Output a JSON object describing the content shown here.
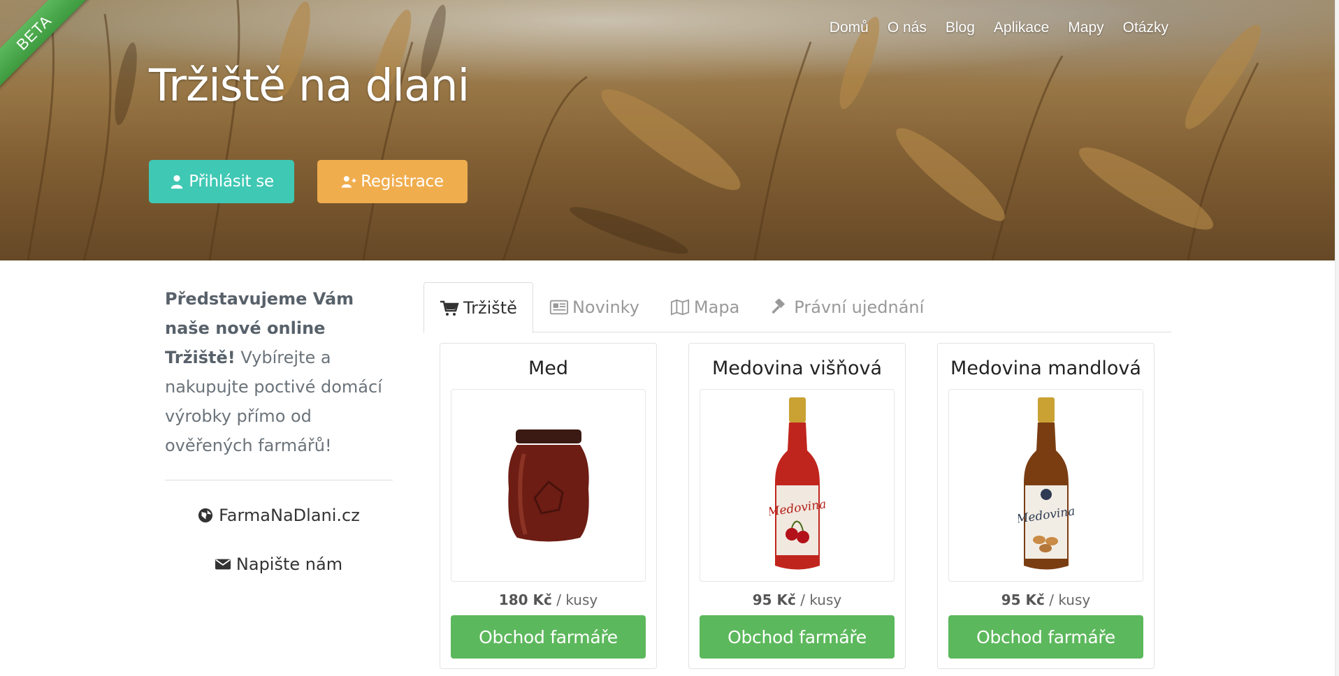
{
  "beta_label": "BETA",
  "header": {
    "title": "Tržiště na dlani",
    "nav": [
      "Domů",
      "O nás",
      "Blog",
      "Aplikace",
      "Mapy",
      "Otázky"
    ],
    "login_label": "Přihlásit se",
    "register_label": "Registrace"
  },
  "sidebar": {
    "intro_bold": "Představujeme Vám naše nové online Tržiště!",
    "intro_text": "Vybírejte a nakupujte poctivé domácí výrobky přímo od ověřených farmářů!",
    "links": [
      {
        "label": "FarmaNaDlani.cz",
        "icon": "globe-icon"
      },
      {
        "label": "Napište nám",
        "icon": "envelope-icon"
      }
    ]
  },
  "tabs": [
    {
      "label": "Tržiště",
      "icon": "cart-icon",
      "active": true
    },
    {
      "label": "Novinky",
      "icon": "newspaper-icon",
      "active": false
    },
    {
      "label": "Mapa",
      "icon": "map-icon",
      "active": false
    },
    {
      "label": "Právní ujednání",
      "icon": "gavel-icon",
      "active": false
    }
  ],
  "products": [
    {
      "name": "Med",
      "price": "180 Kč",
      "unit": " / kusy",
      "button": "Obchod farmáře",
      "image": "honey-jar"
    },
    {
      "name": "Medovina višňová",
      "price": "95 Kč",
      "unit": " / kusy",
      "button": "Obchod farmáře",
      "image": "mead-bottle-red"
    },
    {
      "name": "Medovina mandlová",
      "price": "95 Kč",
      "unit": " / kusy",
      "button": "Obchod farmáře",
      "image": "mead-bottle-amber"
    }
  ],
  "colors": {
    "login_button": "#3fc8b4",
    "register_button": "#f0ad4e",
    "shop_button": "#5cb85c",
    "beta_ribbon": "#5cb85c"
  }
}
